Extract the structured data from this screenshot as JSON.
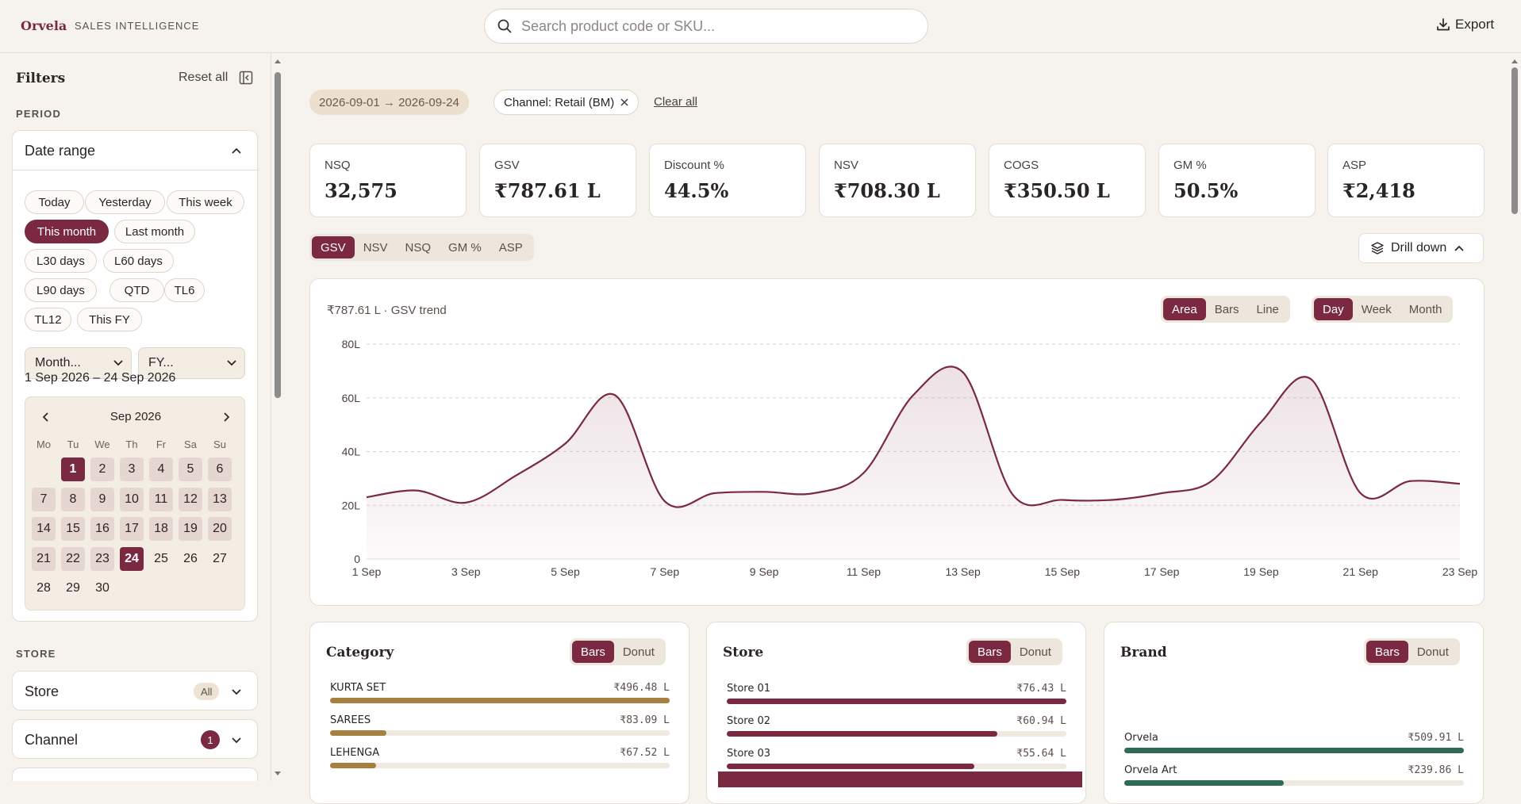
{
  "app": {
    "brand": "Orvela",
    "subtitle": "SALES INTELLIGENCE"
  },
  "search": {
    "placeholder": "Search product code or SKU..."
  },
  "header": {
    "export_label": "Export"
  },
  "sidebar": {
    "title": "Filters",
    "reset_label": "Reset all",
    "period_label": "PERIOD",
    "date_range": {
      "title": "Date range",
      "presets": [
        "Today",
        "Yesterday",
        "This week",
        "This month",
        "Last month",
        "L30 days",
        "L60 days",
        "L90 days",
        "QTD",
        "TL6",
        "TL12",
        "This FY"
      ],
      "selected_preset": "This month",
      "month_select": "Month...",
      "fy_select": "FY...",
      "range_text": "1 Sep 2026 – 24 Sep 2026",
      "calendar": {
        "month": "Sep 2026",
        "weekdays": [
          "Mo",
          "Tu",
          "We",
          "Th",
          "Fr",
          "Sa",
          "Su"
        ],
        "days": [
          "1",
          "2",
          "3",
          "4",
          "5",
          "6",
          "7",
          "8",
          "9",
          "10",
          "11",
          "12",
          "13",
          "14",
          "15",
          "16",
          "17",
          "18",
          "19",
          "20",
          "21",
          "22",
          "23",
          "24",
          "25",
          "26",
          "27",
          "28",
          "29",
          "30"
        ],
        "range_start": 1,
        "range_end": 24
      }
    },
    "store_label": "STORE",
    "store": {
      "title": "Store",
      "badge": "All"
    },
    "channel": {
      "title": "Channel",
      "badge": "1"
    }
  },
  "filters": {
    "date_chip": "2026-09-01 → 2026-09-24",
    "channel_chip": "Channel: Retail (BM)",
    "clear_all": "Clear all"
  },
  "kpis": [
    {
      "label": "NSQ",
      "value": "32,575"
    },
    {
      "label": "GSV",
      "value": "₹787.61 L"
    },
    {
      "label": "Discount %",
      "value": "44.5%"
    },
    {
      "label": "NSV",
      "value": "₹708.30 L"
    },
    {
      "label": "COGS",
      "value": "₹350.50 L"
    },
    {
      "label": "GM %",
      "value": "50.5%"
    },
    {
      "label": "ASP",
      "value": "₹2,418"
    }
  ],
  "metric_tabs": [
    "GSV",
    "NSV",
    "NSQ",
    "GM %",
    "ASP"
  ],
  "metric_selected": "GSV",
  "drill_label": "Drill down",
  "trend": {
    "caption": "₹787.61 L · GSV trend",
    "chart_types": [
      "Area",
      "Bars",
      "Line"
    ],
    "chart_type_selected": "Area",
    "granularity": [
      "Day",
      "Week",
      "Month"
    ],
    "granularity_selected": "Day"
  },
  "chart_data": {
    "type": "area",
    "title": "",
    "xlabel": "",
    "ylabel": "",
    "x": [
      "1 Sep",
      "2 Sep",
      "3 Sep",
      "4 Sep",
      "5 Sep",
      "6 Sep",
      "7 Sep",
      "8 Sep",
      "9 Sep",
      "10 Sep",
      "11 Sep",
      "12 Sep",
      "13 Sep",
      "14 Sep",
      "15 Sep",
      "16 Sep",
      "17 Sep",
      "18 Sep",
      "19 Sep",
      "20 Sep",
      "21 Sep",
      "22 Sep",
      "23 Sep"
    ],
    "x_ticks": [
      "1 Sep",
      "3 Sep",
      "5 Sep",
      "7 Sep",
      "9 Sep",
      "11 Sep",
      "13 Sep",
      "15 Sep",
      "17 Sep",
      "19 Sep",
      "21 Sep",
      "23 Sep"
    ],
    "y_ticks": [
      "0",
      "20L",
      "40L",
      "60L",
      "80L"
    ],
    "ylim": [
      0,
      80
    ],
    "values": [
      23,
      25.5,
      21,
      31,
      43,
      61,
      21.5,
      24.5,
      25,
      24.5,
      32,
      61,
      69.5,
      24,
      22,
      22,
      24.5,
      29,
      51,
      67,
      24.5,
      29,
      28
    ],
    "grid": true,
    "color": "#7a2940"
  },
  "category": {
    "title": "Category",
    "modes": [
      "Bars",
      "Donut"
    ],
    "mode_selected": "Bars",
    "rows": [
      {
        "name": "KURTA SET",
        "value": "₹496.48 L",
        "share": 1.0
      },
      {
        "name": "SAREES",
        "value": "₹83.09 L",
        "share": 0.167
      },
      {
        "name": "LEHENGA",
        "value": "₹67.52 L",
        "share": 0.136
      }
    ],
    "color": "#a6803e"
  },
  "store_card": {
    "title": "Store",
    "modes": [
      "Bars",
      "Donut"
    ],
    "mode_selected": "Bars",
    "rows": [
      {
        "name": "Store 01",
        "value": "₹76.43 L",
        "share": 1.0
      },
      {
        "name": "Store 02",
        "value": "₹60.94 L",
        "share": 0.797
      },
      {
        "name": "Store 03",
        "value": "₹55.64 L",
        "share": 0.728
      }
    ],
    "color": "#7a2940"
  },
  "brand": {
    "title": "Brand",
    "modes": [
      "Bars",
      "Donut"
    ],
    "mode_selected": "Bars",
    "rows": [
      {
        "name": "Orvela",
        "value": "₹509.91 L",
        "share": 1.0
      },
      {
        "name": "Orvela Art",
        "value": "₹239.86 L",
        "share": 0.47
      }
    ],
    "color": "#2e6b57"
  }
}
